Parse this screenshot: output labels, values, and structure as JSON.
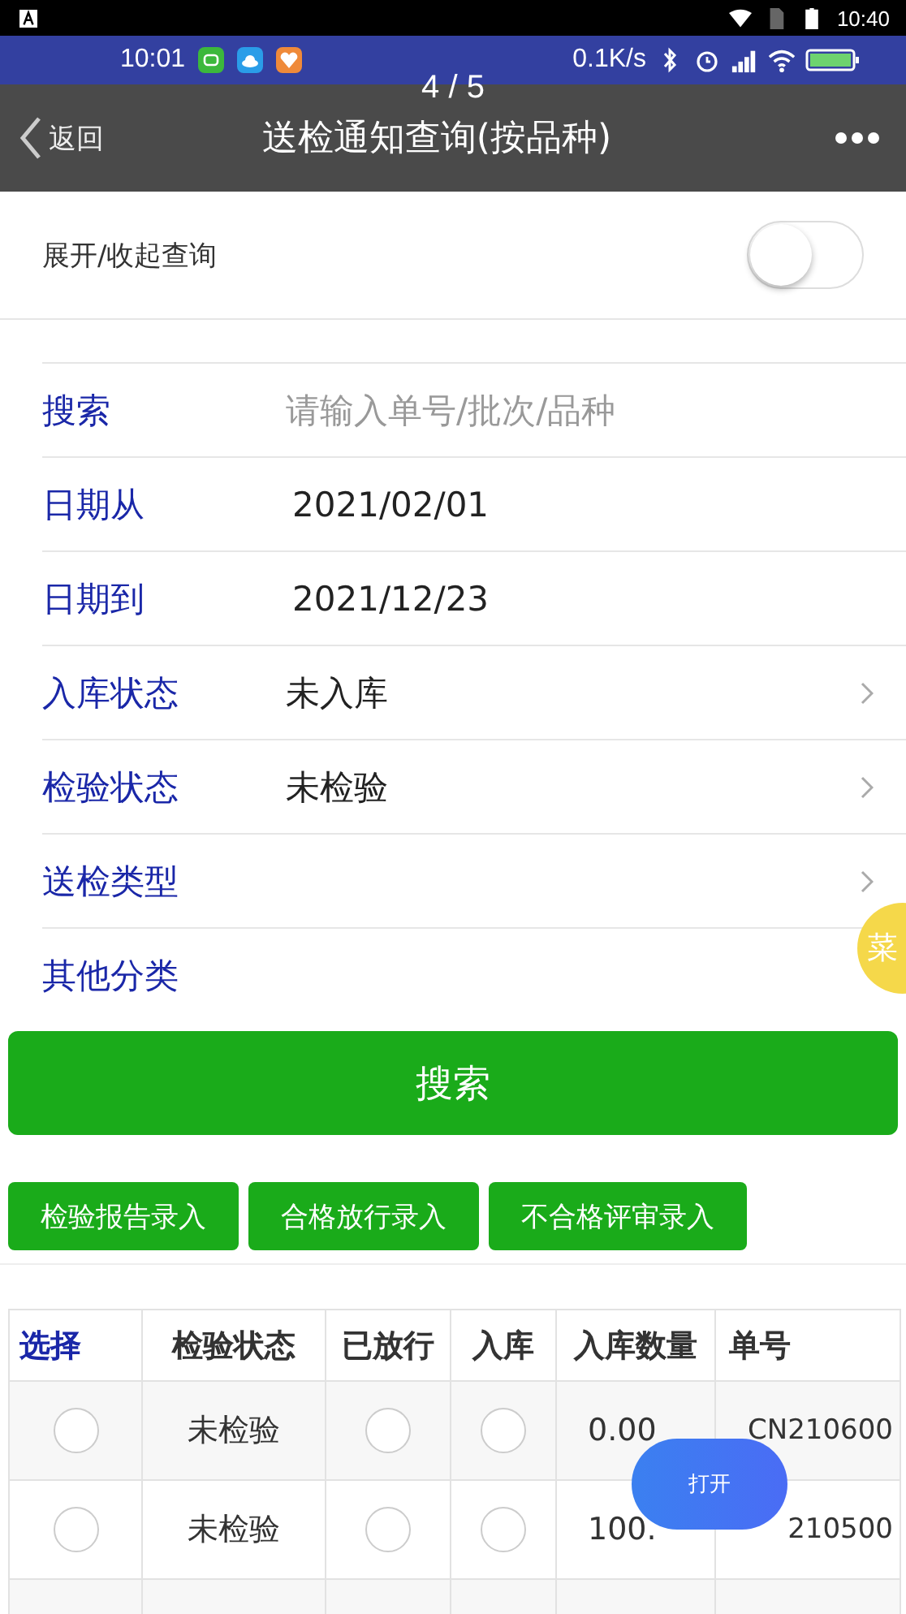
{
  "system_bar": {
    "time": "10:40"
  },
  "inner_status_bar": {
    "time": "10:01",
    "speed": "0.1K/s"
  },
  "page_counter": "4 / 5",
  "header": {
    "back": "返回",
    "title": "送检通知查询(按品种)"
  },
  "toggle": {
    "label": "展开/收起查询",
    "on": false
  },
  "form": [
    {
      "label": "搜索",
      "kind": "input",
      "placeholder": "请输入单号/批次/品种"
    },
    {
      "label": "日期从",
      "kind": "value",
      "value": "2021/02/01"
    },
    {
      "label": "日期到",
      "kind": "value",
      "value": "2021/12/23"
    },
    {
      "label": "入库状态",
      "kind": "select",
      "value": "未入库"
    },
    {
      "label": "检验状态",
      "kind": "select",
      "value": "未检验"
    },
    {
      "label": "送检类型",
      "kind": "select"
    },
    {
      "label": "其他分类",
      "kind": "plain"
    }
  ],
  "menu_badge": "菜",
  "search_button": "搜索",
  "actions": [
    "检验报告录入",
    "合格放行录入",
    "不合格评审录入"
  ],
  "table": {
    "columns": [
      "选择",
      "检验状态",
      "已放行",
      "入库",
      "入库数量",
      "单号"
    ],
    "rows": [
      {
        "selected": false,
        "status": "未检验",
        "released": false,
        "stocked": false,
        "quantity": "0.00",
        "number": "CN210600"
      },
      {
        "selected": false,
        "status": "未检验",
        "released": false,
        "stocked": false,
        "quantity": "100.",
        "number": "210500"
      }
    ]
  },
  "float_button": "打开"
}
